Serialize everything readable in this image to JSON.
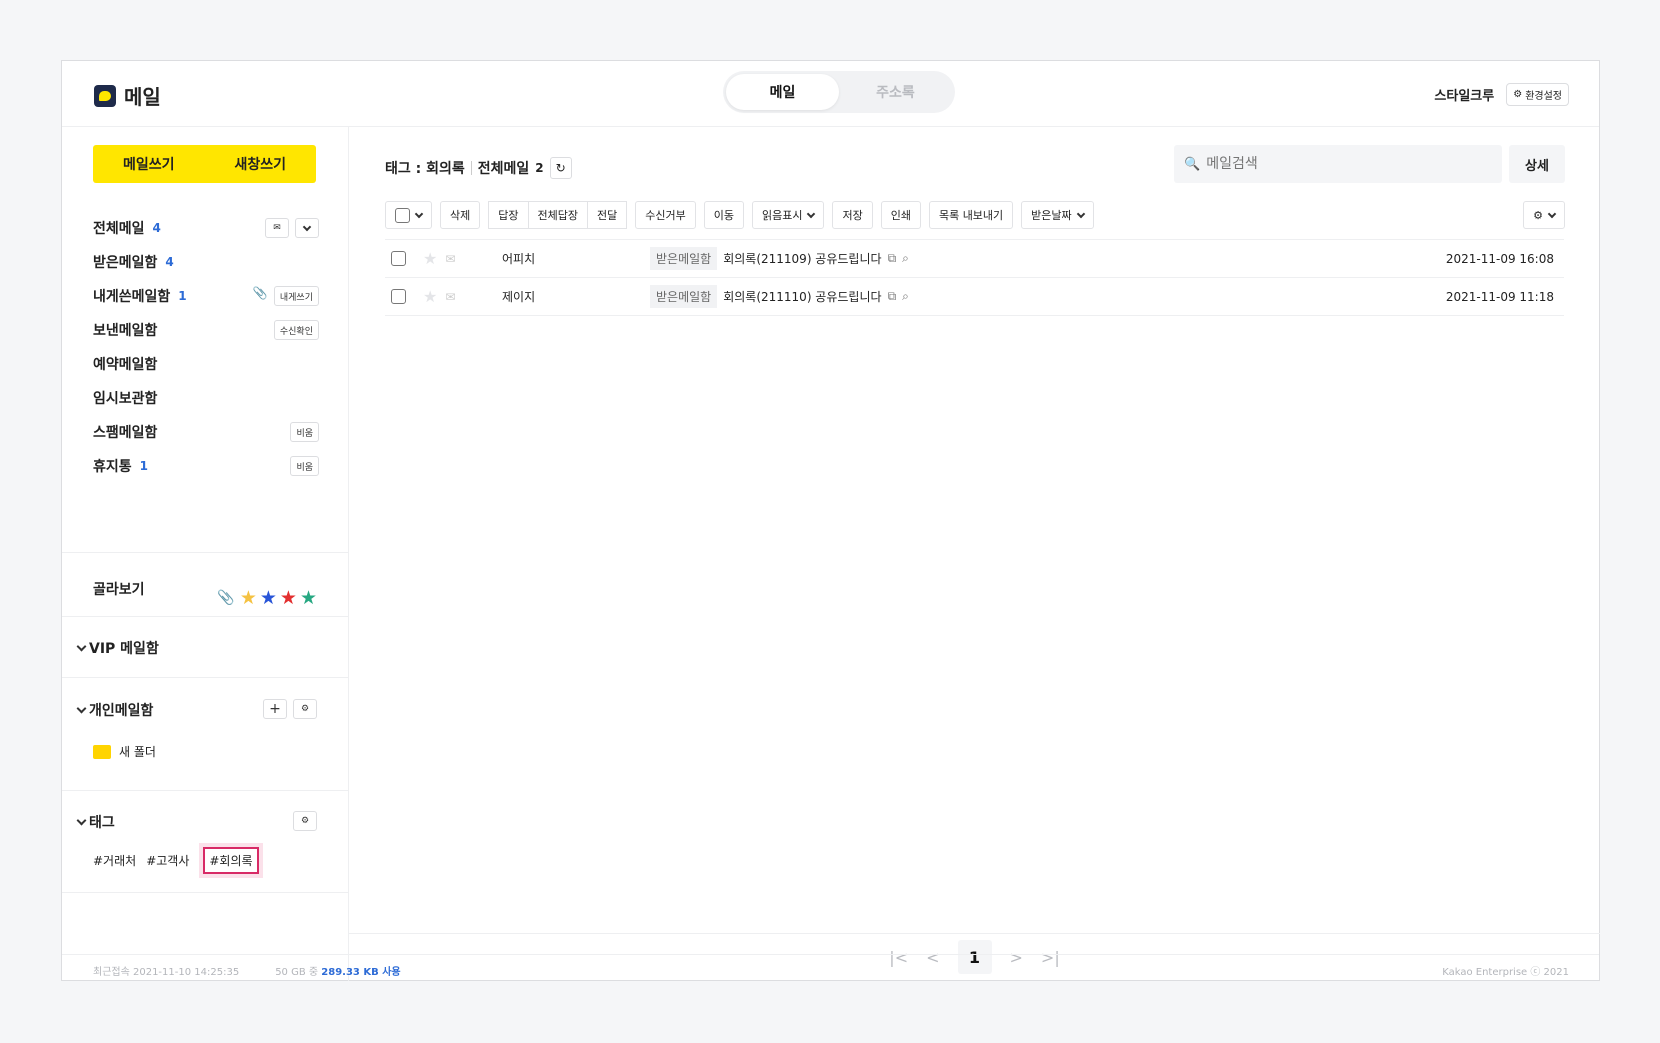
{
  "app": {
    "title": "메일",
    "brand_color": "#ffe600"
  },
  "top_tabs": [
    {
      "label": "메일"
    },
    {
      "label": "주소록"
    }
  ],
  "user": {
    "name": "스타일크루",
    "settings_label": "환경설정"
  },
  "compose": {
    "write": "메일쓰기",
    "new_window": "새창쓰기"
  },
  "folders": [
    {
      "label": "전체메일",
      "count": "4"
    },
    {
      "label": "받은메일함",
      "count": "4"
    },
    {
      "label": "내게쓴메일함",
      "count": "1",
      "action": "내게쓰기"
    },
    {
      "label": "보낸메일함",
      "action": "수신확인"
    },
    {
      "label": "예약메일함"
    },
    {
      "label": "임시보관함"
    },
    {
      "label": "스팸메일함",
      "action": "비움"
    },
    {
      "label": "휴지통",
      "count": "1",
      "action": "비움"
    }
  ],
  "filter": {
    "label": "골라보기",
    "star_colors": [
      "#f5c242",
      "#2855d8",
      "#e32f2f",
      "#27a882"
    ]
  },
  "vip": {
    "label": "VIP 메일함"
  },
  "personal": {
    "label": "개인메일함",
    "folders": [
      "새 폴더"
    ]
  },
  "tags": {
    "label": "태그",
    "items": [
      "#거래처",
      "#고객사",
      "#회의록"
    ]
  },
  "breadcrumb": {
    "tag": "태그 : 회의록",
    "all": "전체메일",
    "count": "2"
  },
  "search": {
    "placeholder": "메일검색",
    "detail": "상세"
  },
  "toolbar": {
    "delete": "삭제",
    "reply": "답장",
    "reply_all": "전체답장",
    "forward": "전달",
    "block": "수신거부",
    "move": "이동",
    "mark_read": "읽음표시",
    "save": "저장",
    "print": "인쇄",
    "export": "목록 내보내기",
    "sort": "받은날짜"
  },
  "mails": [
    {
      "sender": "어피치",
      "folder": "받은메일함",
      "subject": "회의록(211109) 공유드립니다",
      "date": "2021-11-09 16:08"
    },
    {
      "sender": "제이지",
      "folder": "받은메일함",
      "subject": "회의록(211110) 공유드립니다",
      "date": "2021-11-09 11:18"
    }
  ],
  "pagination": {
    "current": "1"
  },
  "footer": {
    "last_login": "최근접속 2021-11-10 14:25:35",
    "quota": "50 GB 중",
    "usage": "289.33 KB 사용",
    "copyright": "Kakao Enterprise ⓒ 2021"
  }
}
